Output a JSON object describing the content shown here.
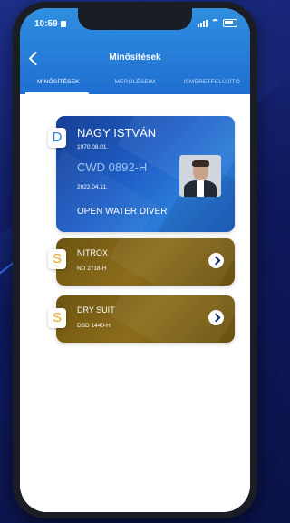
{
  "status_bar": {
    "time": "10:59"
  },
  "header": {
    "title": "Minősítések",
    "tabs": [
      "MINŐSÍTÉSEK",
      "MERÜLÉSEIM",
      "ISMERETFELÚJÍTÓ"
    ]
  },
  "cards": [
    {
      "badge": "D",
      "name": "NAGY ISTVÁN",
      "birth_date": "1970.08.01.",
      "id": "CWD 0892-H",
      "issue_date": "2022.04.11.",
      "level": "OPEN WATER DIVER"
    },
    {
      "badge": "S",
      "title": "NITROX",
      "code": "ND 2718-H"
    },
    {
      "badge": "S",
      "title": "DRY SUIT",
      "code": "DSD 1440-H"
    }
  ],
  "colors": {
    "header_blue": "#1f6fd0",
    "card_blue": "#1f5fc6",
    "card_gold": "#8c6d1b",
    "badge_d": "#2c7fd6",
    "badge_s": "#f0a51b"
  }
}
